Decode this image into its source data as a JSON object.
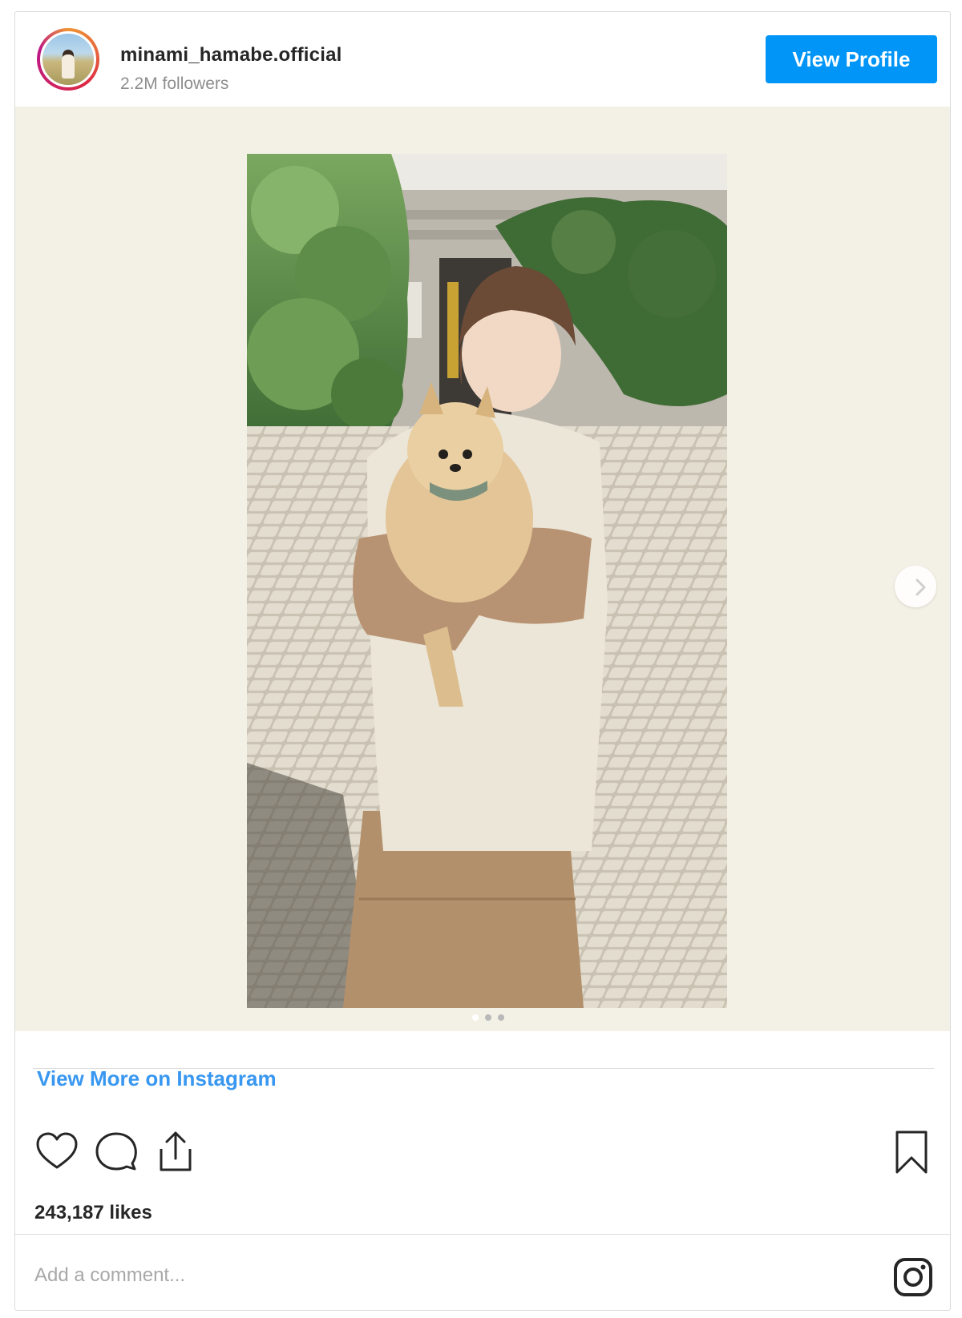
{
  "header": {
    "username": "minami_hamabe.official",
    "followers": "2.2M followers",
    "view_profile_label": "View Profile"
  },
  "media": {
    "carousel_total": 3,
    "carousel_active_index": 0,
    "next_icon": "chevron-right-icon"
  },
  "footer": {
    "view_more_label": "View More on Instagram",
    "likes": "243,187 likes",
    "comment_placeholder": "Add a comment...",
    "icons": [
      "heart-icon",
      "comment-icon",
      "share-icon",
      "bookmark-icon",
      "instagram-logo-icon"
    ]
  },
  "colors": {
    "accent": "#0095f6",
    "link": "#3897f0",
    "media_background": "#f3f1e6"
  }
}
